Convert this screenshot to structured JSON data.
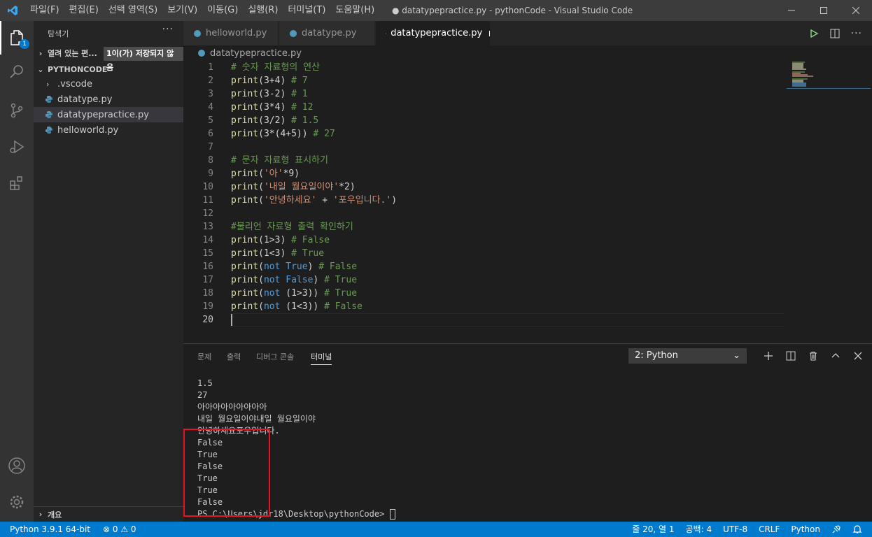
{
  "menu": [
    "파일(F)",
    "편집(E)",
    "선택 영역(S)",
    "보기(V)",
    "이동(G)",
    "실행(R)",
    "터미널(T)",
    "도움말(H)"
  ],
  "window_title": "● datatypepractice.py - pythonCode - Visual Studio Code",
  "activity_badge": "1",
  "sidebar": {
    "title": "탐색기",
    "more": "···",
    "open_editors": "열려 있는 편...",
    "unsaved_badge": "1이(가) 저장되지 않음",
    "project": "PYTHONCODE",
    "items": [
      ".vscode",
      "datatype.py",
      "datatypepractice.py",
      "helloworld.py"
    ],
    "outline": "개요"
  },
  "tabs": [
    "helloworld.py",
    "datatype.py",
    "datatypepractice.py"
  ],
  "breadcrumb": "datatypepractice.py",
  "code": {
    "line_numbers": [
      "1",
      "2",
      "3",
      "4",
      "5",
      "6",
      "7",
      "8",
      "9",
      "10",
      "11",
      "12",
      "13",
      "14",
      "15",
      "16",
      "17",
      "18",
      "19",
      "20"
    ],
    "l1": "# 숫자 자료형의 연산",
    "l2": [
      "print",
      "(3+4) ",
      "# 7"
    ],
    "l3": [
      "print",
      "(3-2) ",
      "# 1"
    ],
    "l4": [
      "print",
      "(3*4) ",
      "# 12"
    ],
    "l5": [
      "print",
      "(3/2) ",
      "# 1.5"
    ],
    "l6": [
      "print",
      "(3*(4+5)) ",
      "# 27"
    ],
    "l8": "# 문자 자료형 표시하기",
    "l9": [
      "print",
      "(",
      "'아'",
      "*9)"
    ],
    "l10": [
      "print",
      "(",
      "'내일 월요일이야'",
      "*2)"
    ],
    "l11": [
      "print",
      "(",
      "'안녕하세요'",
      " + ",
      "'포우입니다.'",
      ")"
    ],
    "l13": "#불리언 자료형 출력 확인하기",
    "l14": [
      "print",
      "(1>3) ",
      "# False"
    ],
    "l15": [
      "print",
      "(1<3) ",
      "# True"
    ],
    "l16": [
      "print",
      "(",
      "not ",
      "True",
      ") ",
      "# False"
    ],
    "l17": [
      "print",
      "(",
      "not ",
      "False",
      ") ",
      "# True"
    ],
    "l18": [
      "print",
      "(",
      "not ",
      "(1>3)) ",
      "# True"
    ],
    "l19": [
      "print",
      "(",
      "not ",
      "(1<3)) ",
      "# False"
    ]
  },
  "panel": {
    "tabs": [
      "문제",
      "출력",
      "디버그 콘솔",
      "터미널"
    ],
    "terminal_selector": "2: Python",
    "output": [
      "1.5",
      "27",
      "아아아아아아아아아",
      "내일 월요일이야내일 월요일이야",
      "안녕하세요포우입니다.",
      "False",
      "True",
      "False",
      "True",
      "True",
      "False"
    ],
    "prompt": "PS C:\\Users\\jdr18\\Desktop\\pythonCode> "
  },
  "status": {
    "interpreter": "Python 3.9.1 64-bit",
    "problems": "⊗ 0 ⚠ 0",
    "position": "줄 20, 열 1",
    "spaces": "공백: 4",
    "encoding": "UTF-8",
    "eol": "CRLF",
    "language": "Python"
  },
  "colors": {
    "accent": "#007acc",
    "highlight_box": "#e81123"
  }
}
